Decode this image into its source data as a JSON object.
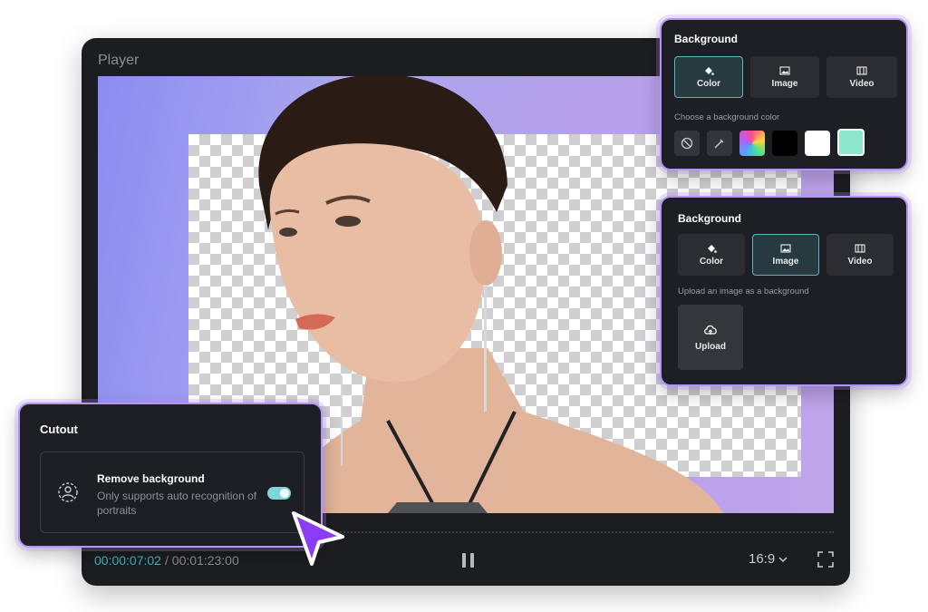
{
  "player": {
    "title": "Player",
    "time_current": "00:00:07:02",
    "time_total": "/ 00:01:23:00",
    "aspect_ratio": "16:9",
    "icons": [
      "pause-icon",
      "chevron-down-icon",
      "fullscreen-icon"
    ]
  },
  "background_color_panel": {
    "title": "Background",
    "tabs": [
      {
        "label": "Color",
        "icon": "paint-bucket-icon",
        "active": true
      },
      {
        "label": "Image",
        "icon": "image-icon",
        "active": false
      },
      {
        "label": "Video",
        "icon": "film-icon",
        "active": false
      }
    ],
    "hint": "Choose a background color",
    "swatches": [
      {
        "name": "none",
        "icon": "no-color-icon"
      },
      {
        "name": "eyedropper",
        "icon": "eyedropper-icon"
      },
      {
        "name": "gradient",
        "color": "rainbow"
      },
      {
        "name": "black",
        "color": "#000000"
      },
      {
        "name": "white",
        "color": "#ffffff"
      },
      {
        "name": "mint",
        "color": "#8ee8cf",
        "selected": true
      }
    ]
  },
  "background_image_panel": {
    "title": "Background",
    "tabs": [
      {
        "label": "Color",
        "icon": "paint-bucket-icon",
        "active": false
      },
      {
        "label": "Image",
        "icon": "image-icon",
        "active": true
      },
      {
        "label": "Video",
        "icon": "film-icon",
        "active": false
      }
    ],
    "hint": "Upload an image as a background",
    "upload_label": "Upload"
  },
  "cutout_panel": {
    "title": "Cutout",
    "option_label": "Remove background",
    "option_desc": "Only supports auto recognition of portraits",
    "toggle_on": true
  },
  "colors": {
    "accent_border": "#b395f5",
    "active_tab": "#57b9c8",
    "panel_bg": "#1e1f24",
    "time_accent": "#3fb6c4"
  }
}
